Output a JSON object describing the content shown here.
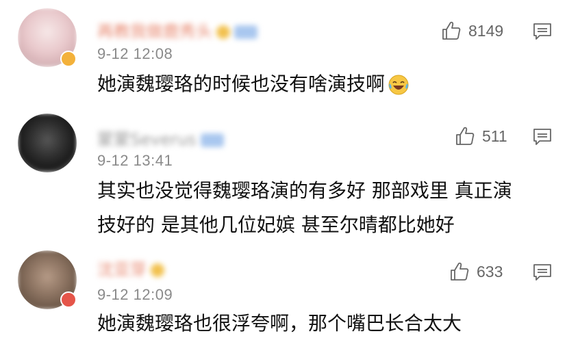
{
  "comments": [
    {
      "user_name": "再教我做鹿秀头",
      "time": "9-12 12:08",
      "text": "她演魏璎珞的时候也没有啥演技啊",
      "emoji": "laughing-crying-emoji",
      "likes": "8149"
    },
    {
      "user_name": "蒙蒙Severus",
      "time": "9-12 13:41",
      "text_line1": "其实也没觉得魏璎珞演的有多好 那部戏里 真正演",
      "text_line2": "技好的 是其他几位妃嫔 甚至尔晴都比她好",
      "likes": "511"
    },
    {
      "user_name": "沈亚芽",
      "time": "9-12 12:09",
      "text": "她演魏璎珞也很浮夸啊，那个嘴巴长合太大",
      "likes": "633"
    }
  ],
  "icons": {
    "like": "thumbs-up-icon",
    "reply": "comment-reply-icon"
  },
  "colors": {
    "name_vip": "#e88a72",
    "name_normal": "#9a9a9a",
    "time": "#8a8a8a",
    "likes": "#666666"
  }
}
